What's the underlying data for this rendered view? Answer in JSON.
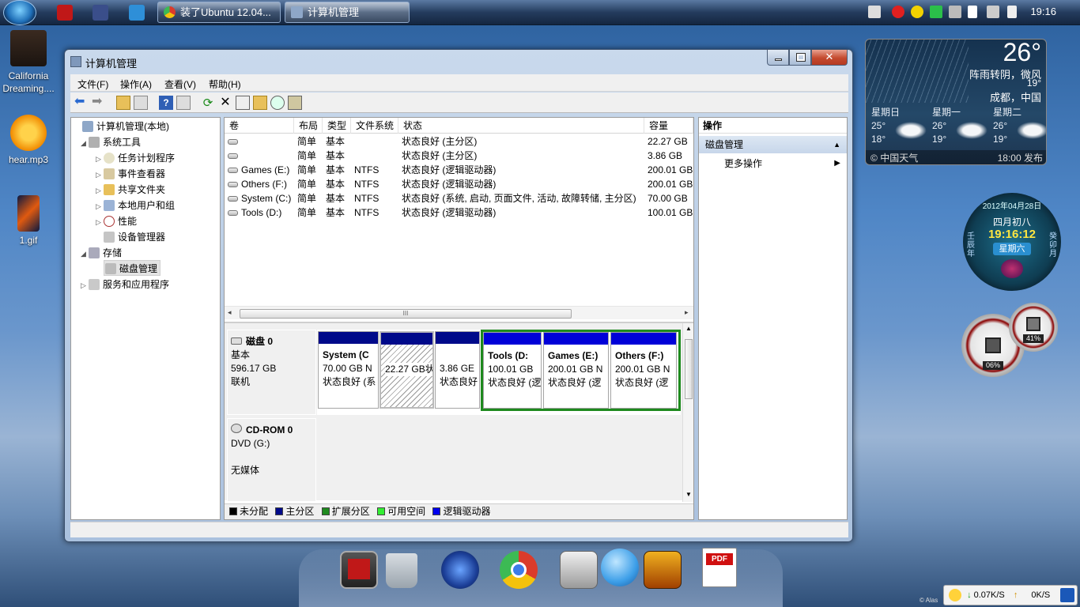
{
  "taskbar": {
    "tasks": [
      {
        "label": "装了Ubuntu 12.04..."
      },
      {
        "label": "计算机管理"
      }
    ],
    "clock": "19:16"
  },
  "desktop": {
    "icons": [
      {
        "label": "California Dreaming...."
      },
      {
        "label": "hear.mp3"
      },
      {
        "label": "1.gif"
      }
    ]
  },
  "window": {
    "title": "计算机管理",
    "menus": [
      "文件(F)",
      "操作(A)",
      "查看(V)",
      "帮助(H)"
    ],
    "tree": [
      {
        "label": "计算机管理(本地)",
        "level": 0
      },
      {
        "label": "系统工具",
        "level": 1,
        "expander": "◢"
      },
      {
        "label": "任务计划程序",
        "level": 2,
        "expander": "▷"
      },
      {
        "label": "事件查看器",
        "level": 2,
        "expander": "▷"
      },
      {
        "label": "共享文件夹",
        "level": 2,
        "expander": "▷"
      },
      {
        "label": "本地用户和组",
        "level": 2,
        "expander": "▷"
      },
      {
        "label": "性能",
        "level": 2,
        "expander": "▷"
      },
      {
        "label": "设备管理器",
        "level": 2,
        "expander": ""
      },
      {
        "label": "存储",
        "level": 1,
        "expander": "◢"
      },
      {
        "label": "磁盘管理",
        "level": 2,
        "expander": ""
      },
      {
        "label": "服务和应用程序",
        "level": 1,
        "expander": "▷"
      }
    ],
    "volume_table": {
      "headers": [
        "卷",
        "布局",
        "类型",
        "文件系统",
        "状态",
        "容量"
      ],
      "rows": [
        [
          "",
          "简单",
          "基本",
          "",
          "状态良好 (主分区)",
          "22.27 GB"
        ],
        [
          "",
          "简单",
          "基本",
          "",
          "状态良好 (主分区)",
          "3.86 GB"
        ],
        [
          "Games (E:)",
          "简单",
          "基本",
          "NTFS",
          "状态良好 (逻辑驱动器)",
          "200.01 GB"
        ],
        [
          "Others (F:)",
          "简单",
          "基本",
          "NTFS",
          "状态良好 (逻辑驱动器)",
          "200.01 GB"
        ],
        [
          "System (C:)",
          "简单",
          "基本",
          "NTFS",
          "状态良好 (系统, 启动, 页面文件, 活动, 故障转储, 主分区)",
          "70.00 GB"
        ],
        [
          "Tools (D:)",
          "简单",
          "基本",
          "NTFS",
          "状态良好 (逻辑驱动器)",
          "100.01 GB"
        ]
      ]
    },
    "scroll_grip": "III",
    "disk0": {
      "name": "磁盘 0",
      "type": "基本",
      "size": "596.17 GB",
      "status": "联机",
      "partitions": [
        {
          "name": "System (C",
          "size": "70.00 GB N",
          "status": "状态良好 (系"
        },
        {
          "name": "",
          "size": "22.27 GB",
          "status": "状态良好 ("
        },
        {
          "name": "",
          "size": "3.86 GE",
          "status": "状态良好"
        },
        {
          "name": "Tools (D:",
          "size": "100.01 GB",
          "status": "状态良好 (逻"
        },
        {
          "name": "Games (E:)",
          "size": "200.01 GB N",
          "status": "状态良好 (逻"
        },
        {
          "name": "Others (F:)",
          "size": "200.01 GB N",
          "status": "状态良好 (逻"
        }
      ]
    },
    "cdrom": {
      "name": "CD-ROM 0",
      "drive": "DVD (G:)",
      "status": "无媒体"
    },
    "legend": [
      {
        "label": "未分配",
        "color": "#000000"
      },
      {
        "label": "主分区",
        "color": "#000a8a"
      },
      {
        "label": "扩展分区",
        "color": "#1f8a1f"
      },
      {
        "label": "可用空间",
        "color": "#33ee33"
      },
      {
        "label": "逻辑驱动器",
        "color": "#0000ee"
      }
    ],
    "actions": {
      "header": "操作",
      "section": "磁盘管理",
      "more": "更多操作"
    }
  },
  "weather": {
    "temp": "26°",
    "desc": "阵雨转阴，微风",
    "low": "19°",
    "city": "成都，中国",
    "forecast": [
      {
        "day": "星期日",
        "high": "25°",
        "low": "18°"
      },
      {
        "day": "星期一",
        "high": "26°",
        "low": "19°"
      },
      {
        "day": "星期二",
        "high": "26°",
        "low": "19°"
      }
    ],
    "source": "中国天气",
    "published": "18:00 发布"
  },
  "calendar": {
    "date": "2012年04月28日",
    "lunar": "四月初八",
    "time": "19:16:12",
    "weekday": "星期六",
    "left_text": "壬辰年",
    "right_text": "癸卯月"
  },
  "gauges": {
    "cpu": "06%",
    "mem": "41%"
  },
  "network": {
    "down": "0.07K/S",
    "up": "0K/S"
  },
  "watermark": "© Alas"
}
